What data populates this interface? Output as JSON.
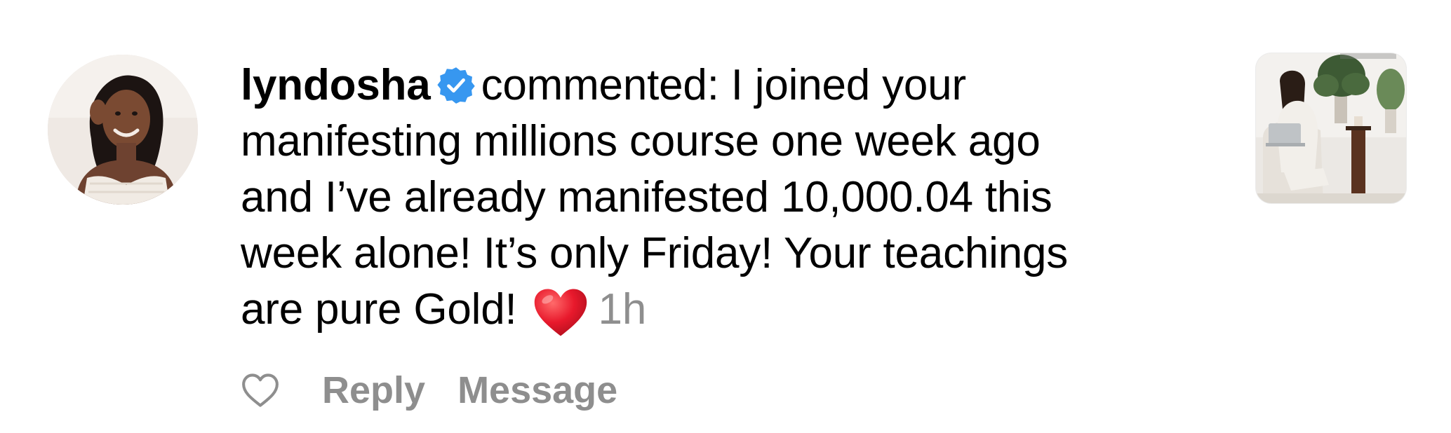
{
  "comment": {
    "username": "lyndosha",
    "verified": true,
    "lines": [
      "commented: I joined your",
      "manifesting millions course one week ago",
      "and I’ve already manifested 10,000.04 this",
      "week alone! It’s only Friday! Your teachings",
      "are pure Gold!"
    ],
    "emoji": "heart-emoji",
    "time": "1h"
  },
  "actions": {
    "reply_label": "Reply",
    "message_label": "Message"
  },
  "colors": {
    "text": "#000000",
    "secondary": "#8e8e8e",
    "verified_blue": "#3797f0",
    "heart_red": "#e8192c"
  },
  "icons": {
    "avatar": "avatar-photo",
    "verified": "verified-badge-icon",
    "like": "heart-outline-icon",
    "thumbnail": "post-thumbnail"
  }
}
